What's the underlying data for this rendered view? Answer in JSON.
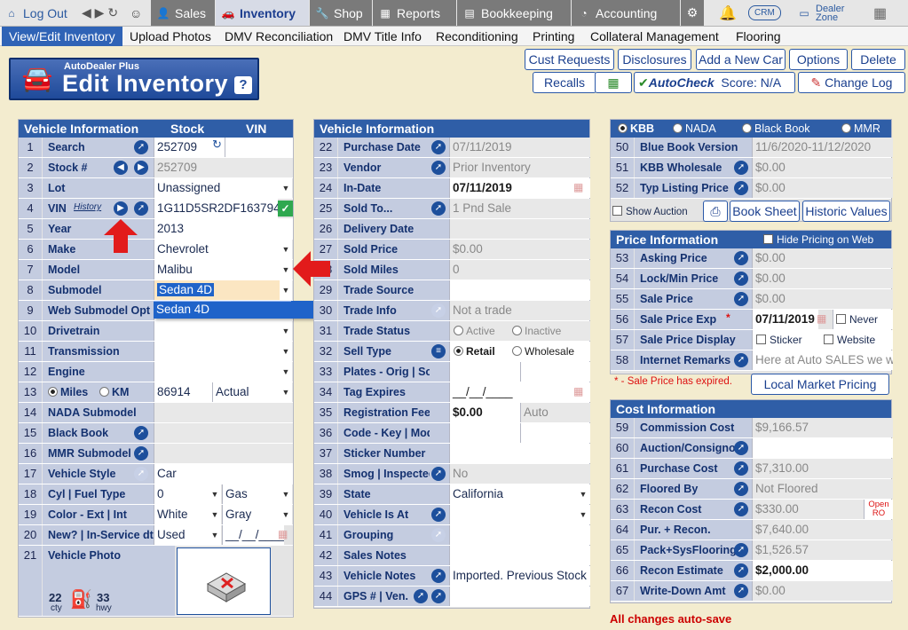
{
  "topbar": {
    "logout": "Log Out",
    "sales": "Sales",
    "inventory": "Inventory",
    "shop": "Shop",
    "reports": "Reports",
    "bookkeeping": "Bookkeeping",
    "accounting": "Accounting",
    "crm": "CRM",
    "dealer_zone": "Dealer Zone"
  },
  "subnav": [
    "View/Edit Inventory",
    "Upload Photos",
    "DMV Reconciliation",
    "DMV Title Info",
    "Reconditioning",
    "Printing",
    "Collateral Management",
    "Flooring"
  ],
  "title": {
    "small": "AutoDealer Plus",
    "big": "Edit Inventory",
    "help": "?"
  },
  "buttons": {
    "cust_requests": "Cust Requests",
    "disclosures": "Disclosures",
    "add_car": "Add a New Car",
    "options": "Options",
    "delete": "Delete",
    "recalls": "Recalls",
    "autocheck": "AutoCheck",
    "score": "Score:  N/A",
    "change_log": "Change Log"
  },
  "left": {
    "head": {
      "title": "Vehicle Information",
      "stock": "Stock",
      "vin": "VIN"
    },
    "rows": [
      {
        "n": "1",
        "label": "Search",
        "value": "252709"
      },
      {
        "n": "2",
        "label": "Stock #",
        "value": "252709"
      },
      {
        "n": "3",
        "label": "Lot",
        "value": "Unassigned"
      },
      {
        "n": "4",
        "label": "VIN",
        "history": "History",
        "value": "1G11D5SR2DF163794"
      },
      {
        "n": "5",
        "label": "Year",
        "value": "2013"
      },
      {
        "n": "6",
        "label": "Make",
        "value": "Chevrolet"
      },
      {
        "n": "7",
        "label": "Model",
        "value": "Malibu"
      },
      {
        "n": "8",
        "label": "Submodel",
        "value": "Sedan 4D"
      },
      {
        "n": "9",
        "label": "Web Submodel Opt",
        "value": ""
      },
      {
        "n": "10",
        "label": "Drivetrain",
        "value": ""
      },
      {
        "n": "11",
        "label": "Transmission",
        "value": ""
      },
      {
        "n": "12",
        "label": "Engine",
        "value": ""
      },
      {
        "n": "13",
        "label": "",
        "value": "86914",
        "value2": "Actual",
        "miles": "Miles",
        "km": "KM"
      },
      {
        "n": "14",
        "label": "NADA Submodel",
        "value": ""
      },
      {
        "n": "15",
        "label": "Black Book",
        "value": ""
      },
      {
        "n": "16",
        "label": "MMR Submodel",
        "value": ""
      },
      {
        "n": "17",
        "label": "Vehicle Style",
        "value": "Car"
      },
      {
        "n": "18",
        "label": "Cyl | Fuel Type",
        "value": "0",
        "value2": "Gas"
      },
      {
        "n": "19",
        "label": "Color - Ext | Int",
        "value": "White",
        "value2": "Gray"
      },
      {
        "n": "20",
        "label": "New? | In-Service dt",
        "value": "Used",
        "value2": "__/__/____"
      },
      {
        "n": "21",
        "label": "Vehicle Photo",
        "value": ""
      }
    ],
    "dropdown_option": "Sedan 4D",
    "mpg": {
      "city": "22",
      "city_label": "cty",
      "hwy": "33",
      "hwy_label": "hwy"
    }
  },
  "mid": {
    "head": "Vehicle Information",
    "rows": [
      {
        "n": "22",
        "label": "Purchase Date",
        "value": "07/11/2019"
      },
      {
        "n": "23",
        "label": "Vendor",
        "value": "Prior Inventory"
      },
      {
        "n": "24",
        "label": "In-Date",
        "value": "07/11/2019"
      },
      {
        "n": "25",
        "label": "Sold To...",
        "value": "1 Pnd Sale"
      },
      {
        "n": "26",
        "label": "Delivery Date",
        "value": ""
      },
      {
        "n": "27",
        "label": "Sold Price",
        "value": "$0.00"
      },
      {
        "n": "28",
        "label": "Sold Miles",
        "value": "0"
      },
      {
        "n": "29",
        "label": "Trade Source",
        "value": ""
      },
      {
        "n": "30",
        "label": "Trade Info",
        "value": "Not a trade"
      },
      {
        "n": "31",
        "label": "Trade Status",
        "opt1": "Active",
        "opt2": "Inactive"
      },
      {
        "n": "32",
        "label": "Sell Type",
        "opt1": "Retail",
        "opt2": "Wholesale"
      },
      {
        "n": "33",
        "label": "Plates - Orig | Sold",
        "value": ""
      },
      {
        "n": "34",
        "label": "Tag Expires",
        "value": "__/__/____"
      },
      {
        "n": "35",
        "label": "Registration Fee",
        "value": "$0.00",
        "value2": "Auto"
      },
      {
        "n": "36",
        "label": "Code - Key | Model",
        "value": ""
      },
      {
        "n": "37",
        "label": "Sticker Number",
        "value": ""
      },
      {
        "n": "38",
        "label": "Smog | Inspected",
        "value": "No"
      },
      {
        "n": "39",
        "label": "State",
        "value": "California"
      },
      {
        "n": "40",
        "label": "Vehicle Is At",
        "value": ""
      },
      {
        "n": "41",
        "label": "Grouping",
        "value": ""
      },
      {
        "n": "42",
        "label": "Sales Notes",
        "value": ""
      },
      {
        "n": "43",
        "label": "Vehicle Notes",
        "value": "Imported.  Previous Stock"
      },
      {
        "n": "44",
        "label": "GPS # | Ven.",
        "value": ""
      }
    ]
  },
  "right": {
    "book_opts": [
      "KBB",
      "NADA",
      "Black Book",
      "MMR"
    ],
    "book_rows": [
      {
        "n": "50",
        "label": "Blue Book Version",
        "value": "11/6/2020-11/12/2020"
      },
      {
        "n": "51",
        "label": "KBB Wholesale",
        "value": "$0.00"
      },
      {
        "n": "52",
        "label": "Typ Listing Price",
        "value": "$0.00"
      }
    ],
    "show_auction": "Show Auction",
    "book_sheet": "Book Sheet",
    "historic_values": "Historic Values",
    "price_head": "Price Information",
    "hide_pricing": "Hide Pricing on Web",
    "price_rows": [
      {
        "n": "53",
        "label": "Asking Price",
        "value": "$0.00"
      },
      {
        "n": "54",
        "label": "Lock/Min Price",
        "value": "$0.00"
      },
      {
        "n": "55",
        "label": "Sale Price",
        "value": "$0.00"
      },
      {
        "n": "56",
        "label": "Sale Price Exp",
        "value": "07/11/2019",
        "extra": "Never"
      },
      {
        "n": "57",
        "label": "Sale Price Display",
        "opt1": "Sticker",
        "opt2": "Website"
      },
      {
        "n": "58",
        "label": "Internet Remarks",
        "value": "Here at Auto SALES we w"
      }
    ],
    "expired_note": "* - Sale Price has expired.",
    "local_market": "Local Market Pricing",
    "cost_head": "Cost Information",
    "cost_rows": [
      {
        "n": "59",
        "label": "Commission Cost",
        "value": "$9,166.57"
      },
      {
        "n": "60",
        "label": "Auction/Consignor",
        "value": ""
      },
      {
        "n": "61",
        "label": "Purchase Cost",
        "value": "$7,310.00"
      },
      {
        "n": "62",
        "label": "Floored By",
        "value": "Not Floored"
      },
      {
        "n": "63",
        "label": "Recon Cost",
        "value": "$330.00",
        "extra": "Open RO"
      },
      {
        "n": "64",
        "label": "Pur. + Recon.",
        "value": "$7,640.00"
      },
      {
        "n": "65",
        "label": "Pack+SysFlooring",
        "value": "$1,526.57"
      },
      {
        "n": "66",
        "label": "Recon Estimate",
        "value": "$2,000.00"
      },
      {
        "n": "67",
        "label": "Write-Down Amt",
        "value": "$0.00"
      }
    ],
    "autosave": "All changes auto-save"
  }
}
